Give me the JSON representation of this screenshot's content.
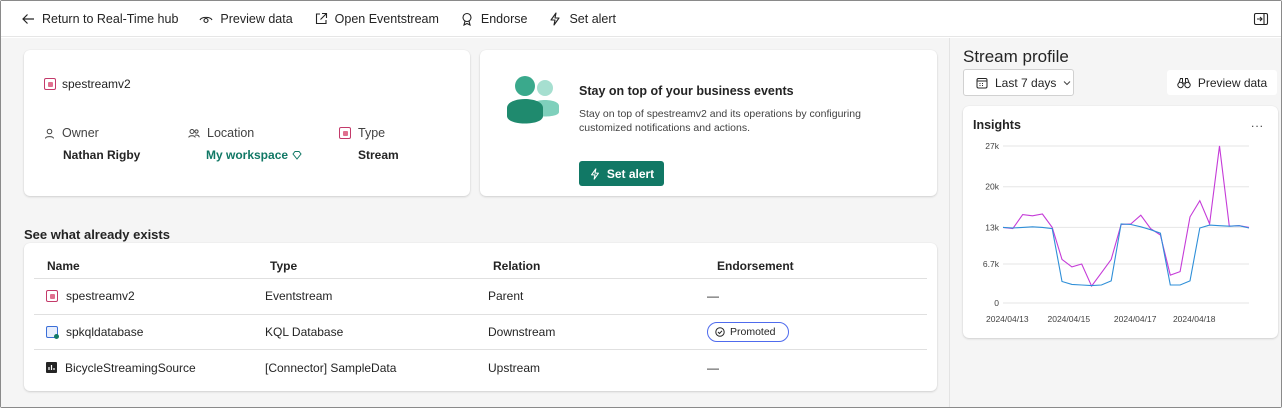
{
  "toolbar": {
    "return": "Return to Real-Time hub",
    "preview": "Preview data",
    "open_eventstream": "Open Eventstream",
    "endorse": "Endorse",
    "set_alert": "Set alert"
  },
  "details": {
    "item_name": "spestreamv2",
    "owner_label": "Owner",
    "owner_value": "Nathan Rigby",
    "location_label": "Location",
    "location_value": "My workspace",
    "type_label": "Type",
    "type_value": "Stream"
  },
  "alert_card": {
    "title": "Stay on top of your business events",
    "description": "Stay on top of spestreamv2 and its operations by configuring customized notifications and actions.",
    "button": "Set alert"
  },
  "existing": {
    "section_title": "See what already exists",
    "columns": [
      "Name",
      "Type",
      "Relation",
      "Endorsement"
    ],
    "rows": [
      {
        "name": "spestreamv2",
        "type": "Eventstream",
        "relation": "Parent",
        "endorsement": "—",
        "icon": "eventstream-icon"
      },
      {
        "name": "spkqldatabase",
        "type": "KQL Database",
        "relation": "Downstream",
        "endorsement": "Promoted",
        "icon": "kql-database-icon"
      },
      {
        "name": "BicycleStreamingSource",
        "type": "[Connector] SampleData",
        "relation": "Upstream",
        "endorsement": "—",
        "icon": "connector-icon"
      }
    ]
  },
  "profile": {
    "title": "Stream profile",
    "range": "Last 7 days",
    "preview": "Preview data",
    "insights_title": "Insights",
    "more": "..."
  },
  "colors": {
    "accent": "#117865",
    "series_pink": "#c53bd8",
    "series_blue": "#2f8fd8"
  },
  "chart_data": {
    "type": "line",
    "title": "",
    "yticks": [
      "27k",
      "20k",
      "13k",
      "6.7k",
      "0"
    ],
    "ytick_values": [
      27000,
      20000,
      13000,
      6700,
      0
    ],
    "xtick_labels": [
      "2024/04/13",
      "2024/04/15",
      "2024/04/17",
      "2024/04/18"
    ],
    "ylim": [
      0,
      27000
    ],
    "series": [
      {
        "values": [
          13000,
          12800,
          15200,
          15000,
          15300,
          13000,
          7500,
          6200,
          6700,
          2900,
          5200,
          7500,
          13500,
          13600,
          15100,
          12800,
          11700,
          4800,
          5400,
          14800,
          17600,
          13600,
          27000,
          13200,
          13300,
          13000
        ]
      },
      {
        "values": [
          13000,
          12900,
          13000,
          13100,
          13000,
          12800,
          3700,
          3200,
          3100,
          3000,
          3100,
          3800,
          13600,
          13500,
          13100,
          12600,
          12000,
          3100,
          3100,
          3800,
          12900,
          13400,
          13300,
          13200,
          13300,
          12900
        ]
      }
    ]
  }
}
